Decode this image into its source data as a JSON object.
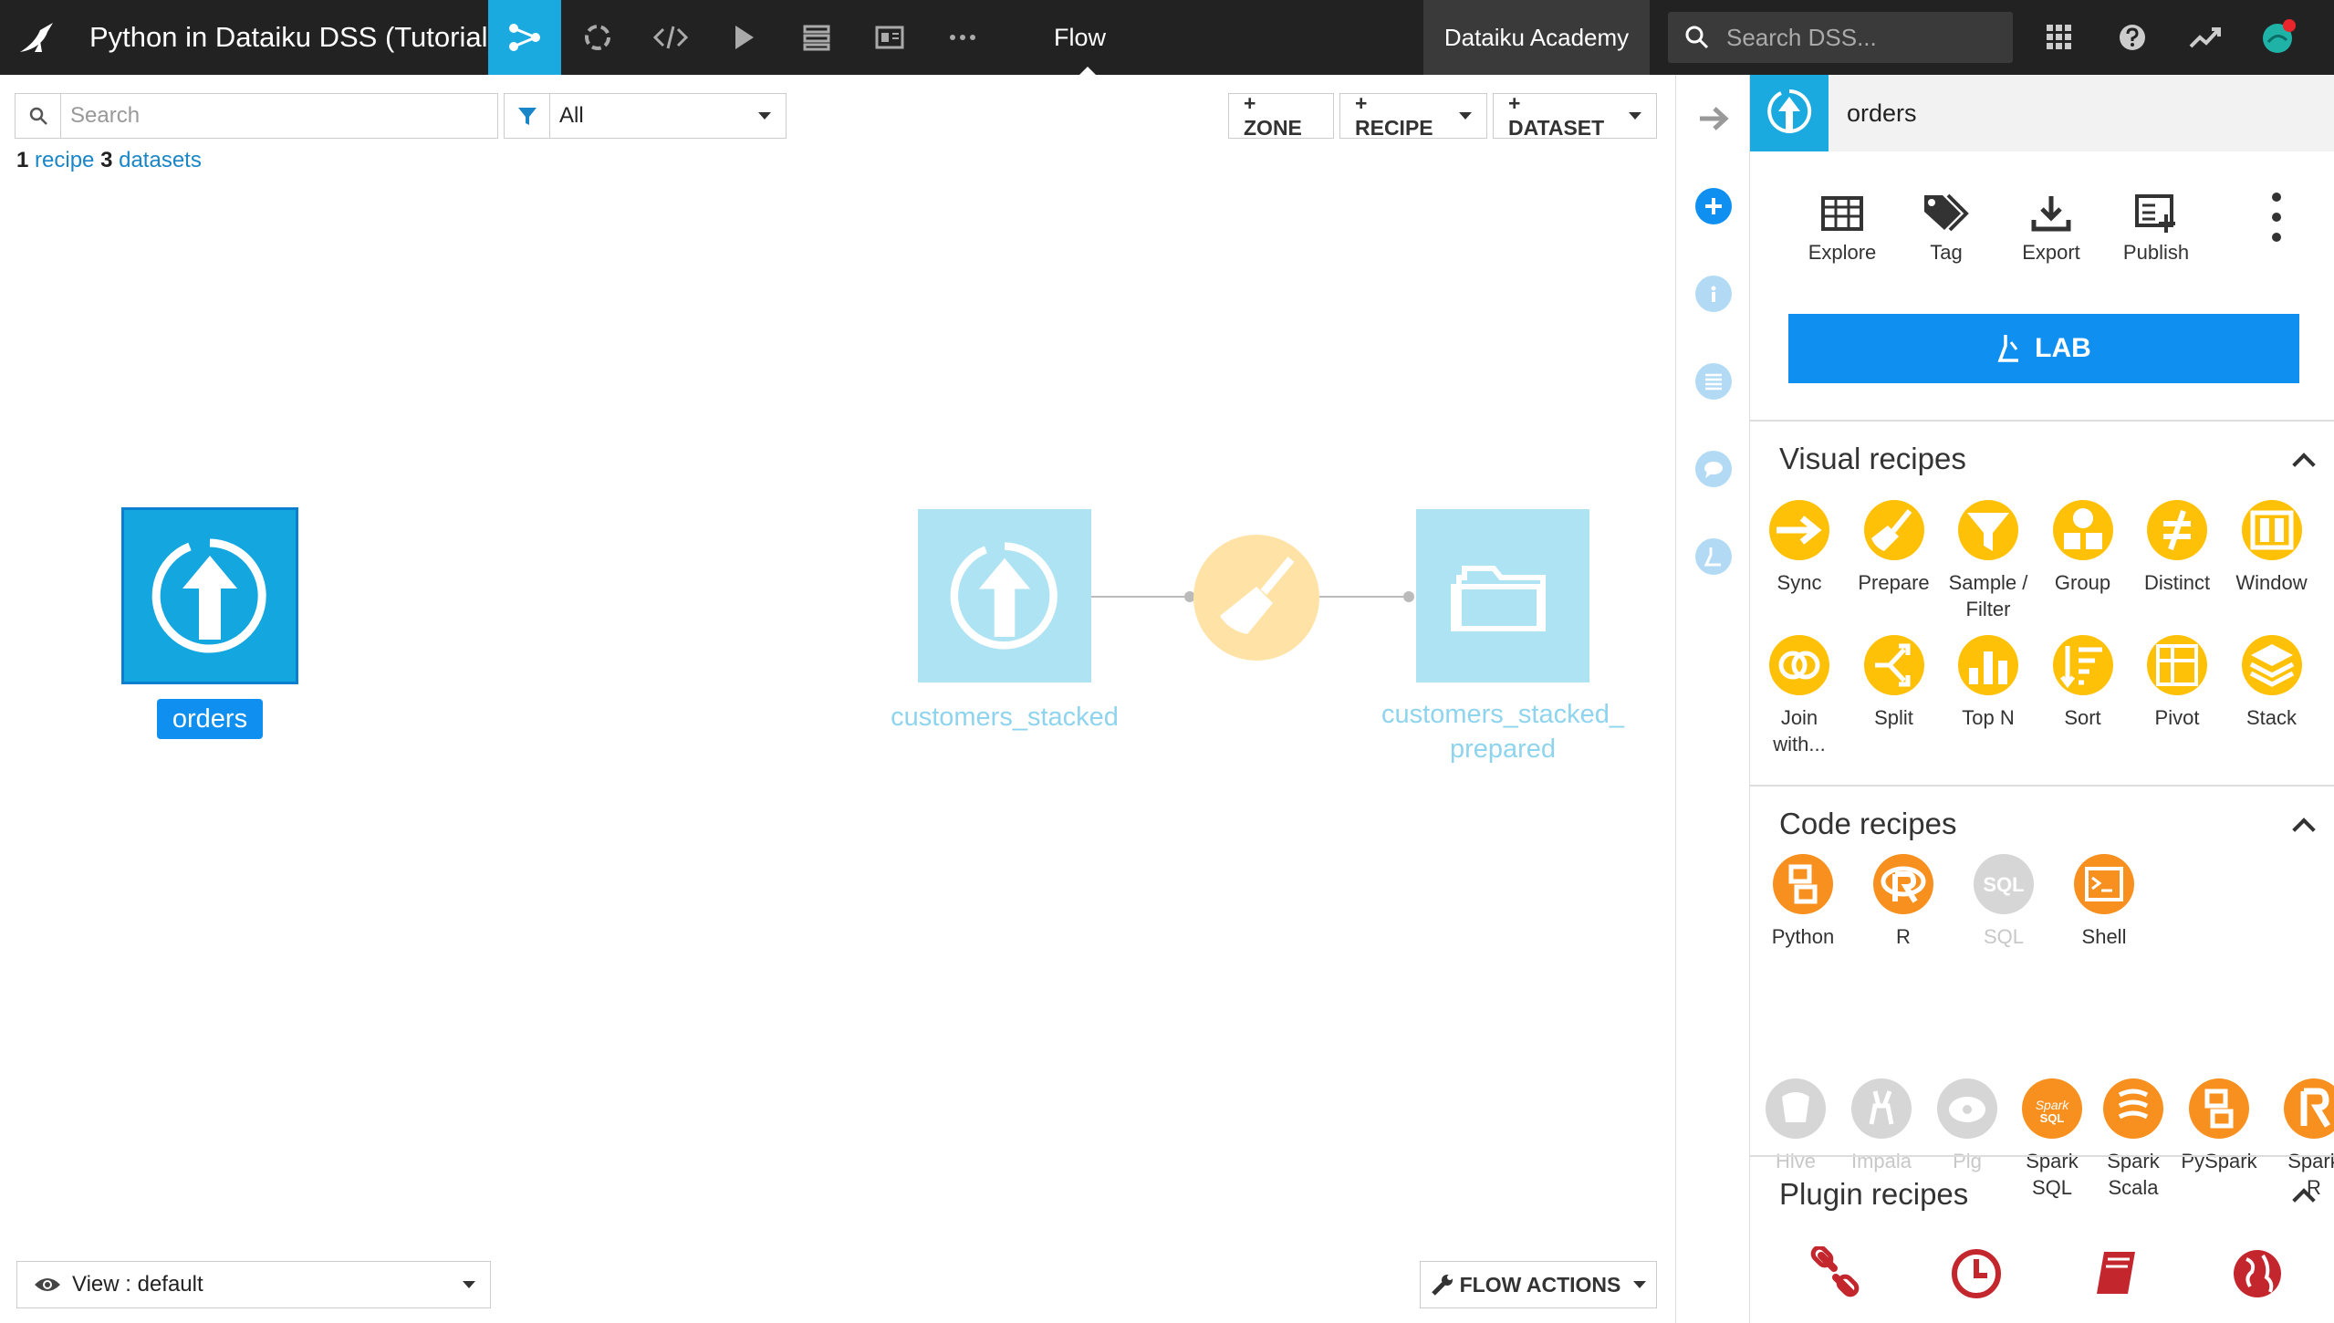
{
  "topbar": {
    "project_title": "Python in Dataiku DSS (Tutorial)",
    "current_view": "Flow",
    "academy_label": "Dataiku Academy",
    "search_placeholder": "Search DSS...",
    "accent": "#1aaadf"
  },
  "filter": {
    "search_placeholder": "Search",
    "filter_value": "All",
    "count_recipes": "1",
    "recipe_word": "recipe",
    "count_datasets": "3",
    "datasets_word": "datasets"
  },
  "flow_buttons": {
    "zone": "+ ZONE",
    "recipe": "+ RECIPE",
    "dataset": "+ DATASET"
  },
  "flow_nodes": {
    "orders": "orders",
    "customers_stacked": "customers_stacked",
    "customers_stacked_prepared_1": "customers_stacked_",
    "customers_stacked_prepared_2": "prepared"
  },
  "bottom": {
    "view_label": "View : default",
    "flow_actions": "FLOW ACTIONS"
  },
  "panel": {
    "dataset_name": "orders",
    "actions": [
      "Explore",
      "Tag",
      "Export",
      "Publish"
    ],
    "lab_label": "LAB",
    "visual_title": "Visual recipes",
    "visual_recipes": [
      {
        "l1": "Sync",
        "l2": ""
      },
      {
        "l1": "Prepare",
        "l2": ""
      },
      {
        "l1": "Sample /",
        "l2": "Filter"
      },
      {
        "l1": "Group",
        "l2": ""
      },
      {
        "l1": "Distinct",
        "l2": ""
      },
      {
        "l1": "Window",
        "l2": ""
      },
      {
        "l1": "Join",
        "l2": "with..."
      },
      {
        "l1": "Split",
        "l2": ""
      },
      {
        "l1": "Top N",
        "l2": ""
      },
      {
        "l1": "Sort",
        "l2": ""
      },
      {
        "l1": "Pivot",
        "l2": ""
      },
      {
        "l1": "Stack",
        "l2": ""
      }
    ],
    "code_title": "Code recipes",
    "code_recipes_row1": [
      {
        "l1": "Python",
        "l2": ""
      },
      {
        "l1": "R",
        "l2": ""
      },
      {
        "l1": "SQL",
        "l2": ""
      },
      {
        "l1": "Shell",
        "l2": ""
      }
    ],
    "code_recipes_row2": [
      {
        "l1": "Hive",
        "l2": ""
      },
      {
        "l1": "Impala",
        "l2": ""
      },
      {
        "l1": "Pig",
        "l2": ""
      },
      {
        "l1": "Spark",
        "l2": "SQL"
      },
      {
        "l1": "Spark",
        "l2": "Scala"
      },
      {
        "l1": "PySpark",
        "l2": ""
      },
      {
        "l1": "Spark",
        "l2": "R"
      }
    ],
    "plugin_title": "Plugin recipes",
    "colors": {
      "visual": "#ffc107",
      "code": "#f7901e",
      "disabled": "#d6d6d6",
      "plugin": "#c4262e"
    }
  }
}
